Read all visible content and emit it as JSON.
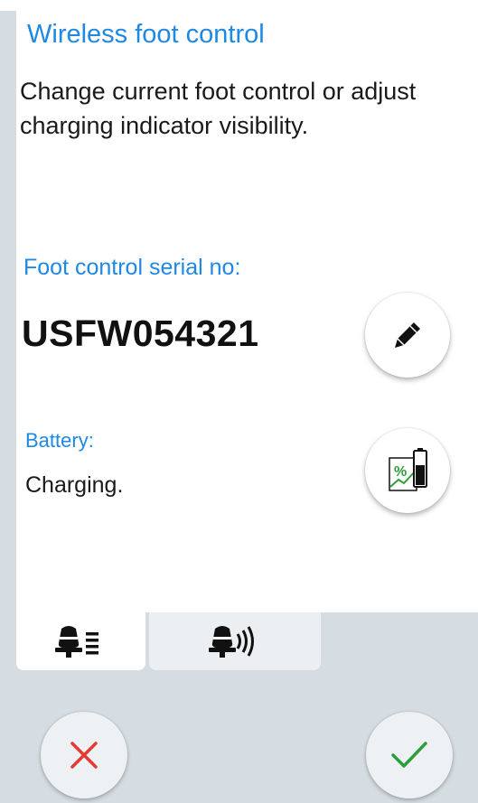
{
  "header": {
    "title": "Wireless foot control",
    "description": "Change current foot control or adjust charging indicator visibility."
  },
  "serial": {
    "label": "Foot control serial no:",
    "value": "USFW054321",
    "edit_icon": "pencil-icon"
  },
  "battery": {
    "label": "Battery:",
    "status": "Charging.",
    "indicator_icon": "battery-charging-indicator-icon"
  },
  "tabs": [
    {
      "icon": "foot-control-list-icon",
      "selected": true
    },
    {
      "icon": "foot-control-wireless-icon",
      "selected": false
    }
  ],
  "actions": {
    "cancel_icon": "close-icon",
    "confirm_icon": "checkmark-icon"
  },
  "colors": {
    "accent": "#1e88e5",
    "cancel": "#e53935",
    "confirm": "#2e9e3a",
    "background": "#d6dde2"
  }
}
